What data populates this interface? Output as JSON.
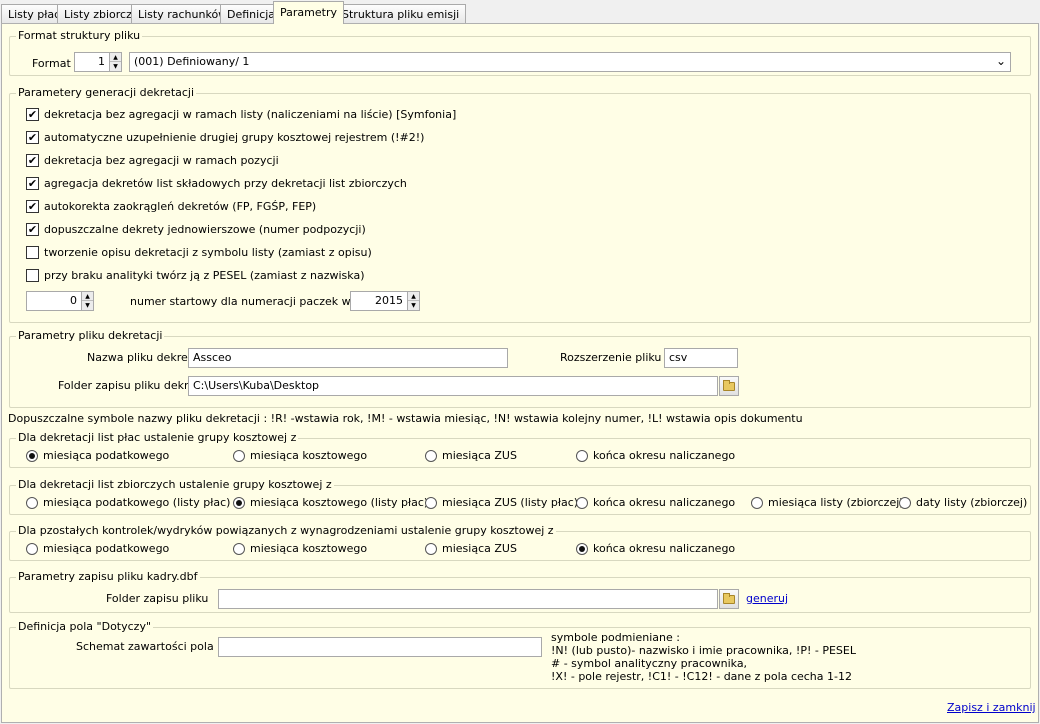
{
  "tabs": [
    {
      "label": "Listy płac"
    },
    {
      "label": "Listy zbiorcze"
    },
    {
      "label": "Listy rachunków"
    },
    {
      "label": "Definicja"
    },
    {
      "label": "Parametry"
    },
    {
      "label": "Struktura pliku emisji"
    }
  ],
  "format_group": {
    "title": "Format struktury pliku",
    "label": "Format",
    "number": "1",
    "selected": "(001) Definiowany/ 1"
  },
  "generation_group": {
    "title": "Parametery generacji dekretacji",
    "options": [
      {
        "label": "dekretacja bez agregacji w ramach listy (naliczeniami na liście) [Symfonia]",
        "checked": true
      },
      {
        "label": "automatyczne uzupełnienie drugiej grupy kosztowej rejestrem (!#2!)",
        "checked": true
      },
      {
        "label": "dekretacja bez agregacji w ramach pozycji",
        "checked": true
      },
      {
        "label": "agregacja dekretów list składowych przy dekretacji list zbiorczych",
        "checked": true
      },
      {
        "label": "autokorekta zaokrągleń dekretów (FP, FGŚP, FEP)",
        "checked": true
      },
      {
        "label": "dopuszczalne dekrety jednowierszowe (numer podpozycji)",
        "checked": true
      },
      {
        "label": "tworzenie opisu dekretacji z symbolu listy (zamiast z opisu)",
        "checked": false
      },
      {
        "label": "przy braku analityki twórz ją z PESEL (zamiast z nazwiska)",
        "checked": false
      }
    ],
    "start_number": "0",
    "start_label": "numer startowy dla numeracji paczek  w roku",
    "year": "2015"
  },
  "file_group": {
    "title": "Parametry pliku dekretacji",
    "name_label": "Nazwa pliku dekretacji",
    "name_value": "Assceo",
    "ext_label": "Rozszerzenie pliku",
    "ext_value": "csv",
    "folder_label": "Folder zapisu pliku dekretacji",
    "folder_value": "C:\\Users\\Kuba\\Desktop"
  },
  "symbols_note": "Dopuszczalne symbole nazwy pliku dekretacji : !R! -wstawia rok, !M! - wstawia miesiąc, !N! wstawia kolejny numer, !L! wstawia opis dokumentu",
  "payroll_group": {
    "title": "Dla dekretacji list płac ustalenie grupy kosztowej z",
    "options": [
      {
        "label": "miesiąca podatkowego",
        "selected": true
      },
      {
        "label": "miesiąca kosztowego",
        "selected": false
      },
      {
        "label": "miesiąca ZUS",
        "selected": false
      },
      {
        "label": "końca okresu naliczanego",
        "selected": false
      }
    ]
  },
  "summary_group": {
    "title": "Dla dekretacji list zbiorczych ustalenie grupy kosztowej z",
    "options": [
      {
        "label": "miesiąca podatkowego (listy płac)",
        "selected": false
      },
      {
        "label": "miesiąca kosztowego (listy płac)",
        "selected": true
      },
      {
        "label": "miesiąca ZUS (listy płac)",
        "selected": false
      },
      {
        "label": "końca okresu naliczanego",
        "selected": false
      },
      {
        "label": "miesiąca listy (zbiorczej)",
        "selected": false
      },
      {
        "label": "daty listy (zbiorczej)",
        "selected": false
      }
    ]
  },
  "other_group": {
    "title": "Dla pzostałych kontrolek/wydryków powiązanych z wynagrodzeniami ustalenie grupy kosztowej z",
    "options": [
      {
        "label": "miesiąca podatkowego",
        "selected": false
      },
      {
        "label": "miesiąca kosztowego",
        "selected": false
      },
      {
        "label": "miesiąca ZUS",
        "selected": false
      },
      {
        "label": "końca okresu naliczanego",
        "selected": true
      }
    ]
  },
  "kadry_group": {
    "title": "Parametry zapisu pliku kadry.dbf",
    "folder_label": "Folder zapisu pliku",
    "folder_value": "",
    "generate_link": "generuj"
  },
  "dotyczy_group": {
    "title": "Definicja pola \"Dotyczy\"",
    "schema_label": "Schemat zawartości pola",
    "schema_value": "",
    "symbols_title": "symbole podmieniane :",
    "symbols_lines": [
      "!N! (lub pusto)- nazwisko i imie pracownika, !P! - PESEL",
      " # - symbol analityczny pracownika,",
      "!X! - pole rejestr, !C1! - !C12! - dane z pola cecha 1-12"
    ]
  },
  "save_link": "Zapisz i zamknij"
}
